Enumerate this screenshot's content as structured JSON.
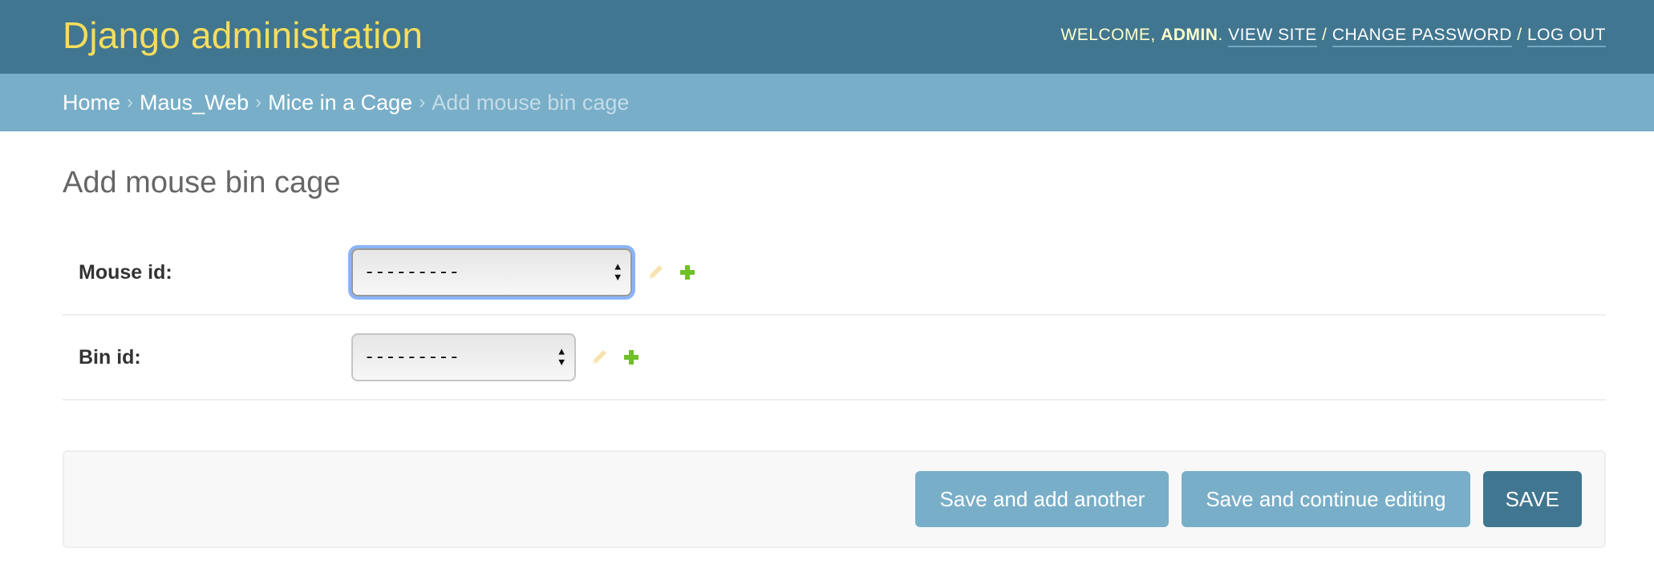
{
  "header": {
    "branding": "Django administration",
    "welcome_prefix": "Welcome,",
    "username": "admin",
    "welcome_suffix": ".",
    "links": {
      "view_site": "View site",
      "change_password": "Change password",
      "log_out": "Log out"
    },
    "separator": "/"
  },
  "breadcrumbs": {
    "items": [
      "Home",
      "Maus_Web",
      "Mice in a Cage"
    ],
    "current": "Add mouse bin cage",
    "separator": "›"
  },
  "page": {
    "title": "Add mouse bin cage"
  },
  "form": {
    "fields": [
      {
        "label": "Mouse id:",
        "selected": "---------",
        "focused": true
      },
      {
        "label": "Bin id:",
        "selected": "---------",
        "focused": false
      }
    ]
  },
  "submit_row": {
    "save_and_add_another": "Save and add another",
    "save_and_continue": "Save and continue editing",
    "save": "Save"
  },
  "colors": {
    "header_bg": "#417690",
    "branding": "#f5dd5d",
    "breadcrumbs_bg": "#79aec8",
    "button_bg": "#79aec8",
    "primary_button_bg": "#417690",
    "add_icon": "#70bf2b",
    "edit_icon_disabled": "#f7e3b0"
  }
}
